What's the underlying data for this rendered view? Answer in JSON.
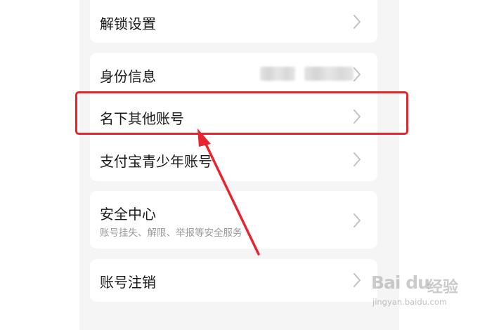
{
  "settings": {
    "items": [
      {
        "label": "解锁设置"
      },
      {
        "label": "身份信息"
      },
      {
        "label": "名下其他账号"
      },
      {
        "label": "支付宝青少年账号"
      },
      {
        "label": "安全中心",
        "subtitle": "账号挂失、解限、举报等安全服务"
      },
      {
        "label": "账号注销"
      }
    ]
  },
  "watermark": {
    "brand": "Bai du",
    "brand_cn": "经验",
    "url": "jingyan.baidu.com"
  },
  "colors": {
    "highlight": "#e8242f",
    "page_bg": "#f5f5f5",
    "card_bg": "#ffffff"
  },
  "icons": {
    "row_arrow": "chevron-right-icon",
    "annotation": "red-arrow-icon"
  }
}
